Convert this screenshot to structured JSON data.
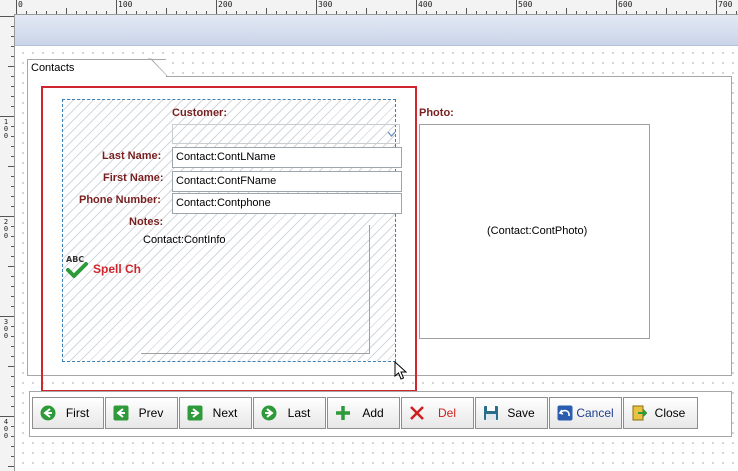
{
  "ruler": {
    "h_labels": [
      "0",
      "100",
      "200",
      "300",
      "400",
      "500",
      "600",
      "700"
    ],
    "v_labels": [
      "1\n0\n0",
      "2\n0\n0",
      "3\n0\n0",
      "4\n0\n0"
    ]
  },
  "tab": {
    "label": "Contacts"
  },
  "form": {
    "customer_label": "Customer:",
    "last_name_label": "Last Name:",
    "last_name_value": "Contact:ContLName",
    "first_name_label": "First Name:",
    "first_name_value": "Contact:ContFName",
    "phone_label": "Phone Number:",
    "phone_value": "Contact:Contphone",
    "notes_label": "Notes:",
    "notes_value": "Contact:ContInfo",
    "spell_icon_text": "ABC",
    "spell_label": "Spell Ch",
    "photo_label": "Photo:",
    "photo_value": "(Contact:ContPhoto)"
  },
  "toolbar": {
    "buttons": [
      {
        "label": "First",
        "icon": "arrow-left-circle-icon"
      },
      {
        "label": "Prev",
        "icon": "arrow-left-square-icon"
      },
      {
        "label": "Next",
        "icon": "arrow-right-square-icon"
      },
      {
        "label": "Last",
        "icon": "arrow-right-circle-icon"
      },
      {
        "label": "Add",
        "icon": "plus-icon"
      },
      {
        "label": "Del",
        "icon": "delete-x-icon"
      },
      {
        "label": "Save",
        "icon": "floppy-disk-icon"
      },
      {
        "label": "Cancel",
        "icon": "undo-icon"
      },
      {
        "label": "Close",
        "icon": "door-exit-icon"
      }
    ]
  },
  "colors": {
    "label_red": "#7a1f1f",
    "selection_red": "#d0262d",
    "group_blue": "#3c7fb4",
    "nav_green": "#2e9a3a",
    "del_red": "#cc1f1f",
    "save_teal": "#2b6e8a",
    "cancel_blue": "#2a5db0"
  }
}
